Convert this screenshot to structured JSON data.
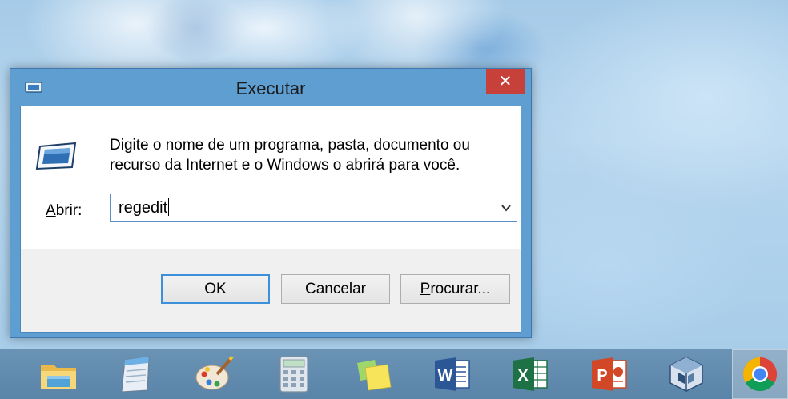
{
  "dialog": {
    "title": "Executar",
    "close_label": "✕",
    "description_line1": "Digite o nome de um programa, pasta, documento ou",
    "description_line2": "recurso da Internet e o Windows o abrirá para você.",
    "open_label_accel": "A",
    "open_label_rest": "brir:",
    "open_value": "regedit",
    "buttons": {
      "ok": "OK",
      "cancel": "Cancelar",
      "browse_accel": "P",
      "browse_rest": "rocurar..."
    }
  },
  "taskbar": {
    "items": [
      {
        "name": "file-explorer-icon"
      },
      {
        "name": "notepad-icon"
      },
      {
        "name": "paint-icon"
      },
      {
        "name": "calculator-icon"
      },
      {
        "name": "sticky-notes-icon"
      },
      {
        "name": "word-icon",
        "letter": "W",
        "color": "#2b5797"
      },
      {
        "name": "excel-icon",
        "letter": "X",
        "color": "#1e7145"
      },
      {
        "name": "powerpoint-icon",
        "letter": "P",
        "color": "#d24726"
      },
      {
        "name": "virtualbox-icon"
      },
      {
        "name": "chrome-icon",
        "active": true
      }
    ]
  },
  "colors": {
    "title_bar": "#5f9ed1",
    "close_button": "#c7403a",
    "taskbar": "#5f89ad",
    "default_button_border": "#3c8fd9"
  }
}
